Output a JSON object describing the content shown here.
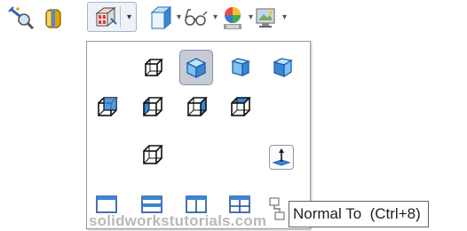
{
  "toolbar": {
    "items": [
      {
        "icon": "zoom-to-area-icon"
      },
      {
        "icon": "section-view-icon"
      },
      {
        "icon": "view-orientation-icon",
        "has_dropdown": true,
        "active": true
      },
      {
        "icon": "display-style-icon",
        "has_dropdown": true
      },
      {
        "icon": "hide-show-items-icon",
        "has_dropdown": true
      },
      {
        "icon": "edit-appearance-icon",
        "has_dropdown": true
      },
      {
        "icon": "apply-scene-icon",
        "has_dropdown": true
      }
    ],
    "dropdown_glyph": "▾"
  },
  "flyout": {
    "views": [
      {
        "name": "front-view",
        "selected": false
      },
      {
        "name": "isometric-view",
        "selected": true
      },
      {
        "name": "dimetric-view",
        "selected": false
      },
      {
        "name": "trimetric-view",
        "selected": false
      },
      {
        "name": "back-view",
        "selected": false
      },
      {
        "name": "left-view",
        "selected": false
      },
      {
        "name": "right-view",
        "selected": false
      },
      {
        "name": "top-view",
        "selected": false
      },
      {
        "name": "bottom-view",
        "selected": false
      },
      {
        "name": "normal-to",
        "selected": false
      },
      {
        "name": "single-view",
        "selected": false
      },
      {
        "name": "two-view-horizontal",
        "selected": false
      },
      {
        "name": "two-view-vertical",
        "selected": false
      },
      {
        "name": "four-view",
        "selected": false
      },
      {
        "name": "link-views",
        "selected": false
      }
    ]
  },
  "tooltip": {
    "text": "Normal To  (Ctrl+8)"
  },
  "watermark": {
    "text": "solidworkstutorials.com"
  },
  "colors": {
    "cube_blue": "#3a86d6",
    "cube_light": "#8fd0f5",
    "selection_bg": "#c5cad6",
    "panel_border": "#9a9a9a"
  }
}
